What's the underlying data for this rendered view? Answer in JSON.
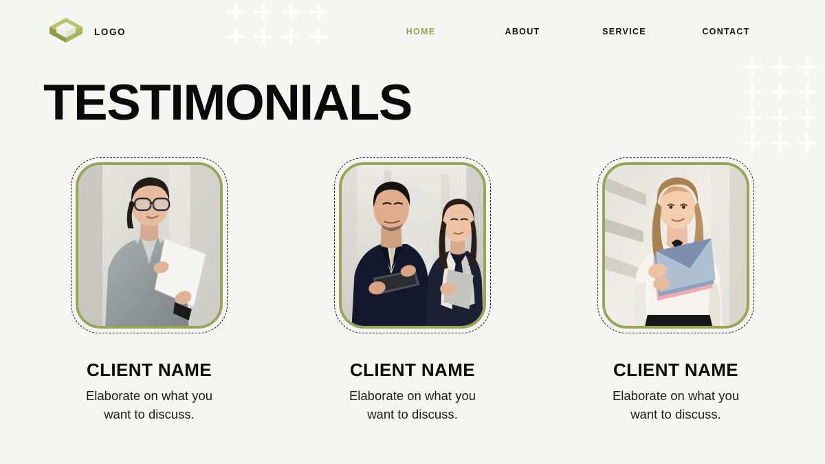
{
  "page": {
    "background_color": "#f5f5f3",
    "accent_color": "#9aa04f",
    "frame_green": "#97a556",
    "text_color": "#0a0a0a"
  },
  "header": {
    "logo_icon": "isometric-diamond-box-logo",
    "brand_name": "LOGO",
    "nav": [
      {
        "label": "HOME",
        "active": true
      },
      {
        "label": "ABOUT",
        "active": false
      },
      {
        "label": "SERVICE",
        "active": false
      },
      {
        "label": "CONTACT",
        "active": false
      }
    ]
  },
  "main": {
    "title": "TESTIMONIALS",
    "cards": [
      {
        "name": "CLIENT NAME",
        "text": "Elaborate on what you want to discuss.",
        "photo_alt": "businesswoman-with-glasses-holding-document"
      },
      {
        "name": "CLIENT NAME",
        "text": "Elaborate on what you want to discuss.",
        "photo_alt": "businessman-and-businesswoman-in-office-corridor"
      },
      {
        "name": "CLIENT NAME",
        "text": "Elaborate on what you want to discuss.",
        "photo_alt": "blonde-businesswoman-holding-folders"
      }
    ]
  },
  "decor": {
    "plus_top": {
      "columns": 4,
      "rows": 2,
      "color": "#ffffff"
    },
    "plus_right": {
      "columns": 3,
      "rows": 4,
      "color": "#ffffff"
    }
  }
}
